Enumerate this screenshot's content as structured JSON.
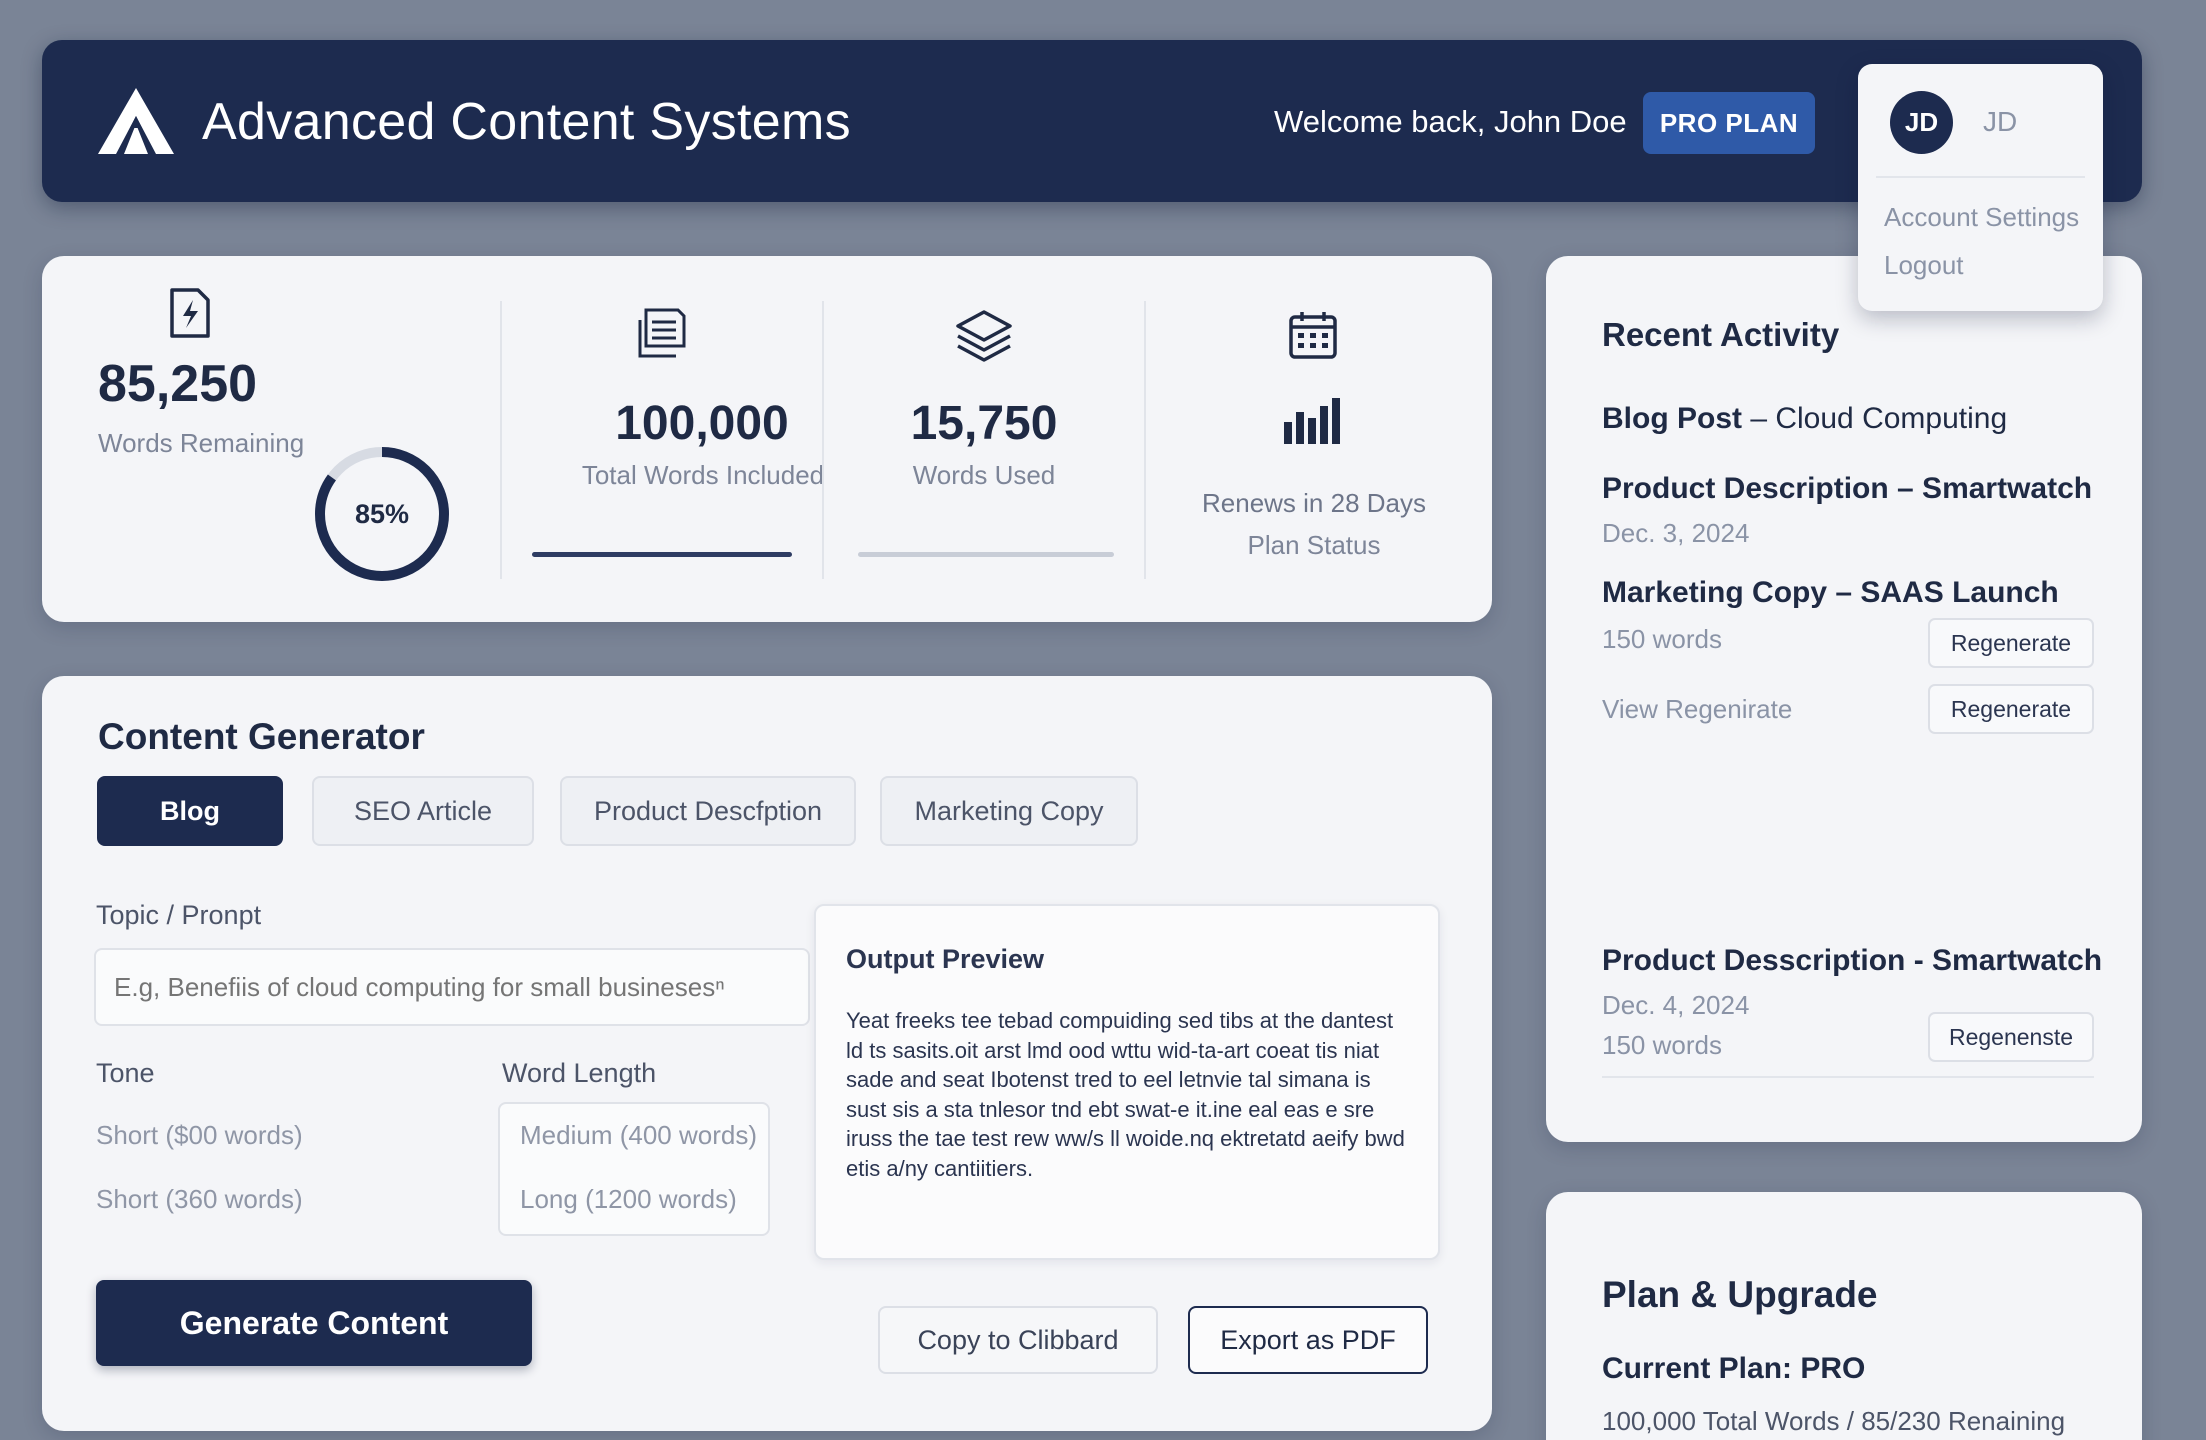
{
  "header": {
    "app_title": "Advanced Content Systems",
    "welcome": "Welcome back, John Doe",
    "plan_badge": "PRO PLAN",
    "user": {
      "initials": "JD",
      "name": "JD",
      "menu": [
        "Account Settings",
        "Logout"
      ]
    }
  },
  "stats": {
    "remaining": {
      "value": "85,250",
      "label": "Words Remaining",
      "percent_text": "85%",
      "percent": 0.85
    },
    "total": {
      "value": "100,000",
      "label": "Total Words Included"
    },
    "used": {
      "value": "15,750",
      "label": "Words Used"
    },
    "renewal": {
      "line1": "Renews in 28 Days",
      "line2": "Plan Status"
    }
  },
  "generator": {
    "title": "Content Generator",
    "tabs": [
      "Blog",
      "SEO Article",
      "Product Descfption",
      "Marketing Copy"
    ],
    "active_tab": "Blog",
    "topic_label": "Topic / Pronpt",
    "topic_placeholder": "E.g, Benefiis of cloud computing for small businesesⁿ",
    "tone_label": "Tone",
    "tone_options": [
      "Short ($00 words)",
      "Short (360 words)"
    ],
    "length_label": "Word Length",
    "length_options": [
      "Medium (400 words)",
      "Long (1200 words)"
    ],
    "generate_button": "Generate Content",
    "preview_title": "Output Preview",
    "preview_text": "Yeat freeks tee tebad compuiding sed tibs at the dantest ld ts sasits.oit arst lmd ood wttu wid-ta-art coeat tis niat sade and seat Ibotenst tred to eel letnvie tal simana is sust sis a sta tnlesor tnd ebt swat-e it.ine eal eas e sre iruss the tae test rew ww/s ll woide.nq ektretatd aeify bwd etis a/ny cantiitiers.",
    "copy_button": "Copy to Clibbard",
    "export_button": "Export as PDF"
  },
  "activity": {
    "title": "Recent Activity",
    "items": [
      {
        "bold": "Blog Post",
        "rest": " – Cloud Computing"
      },
      {
        "title": "Product Description – Smartwatch",
        "date": "Dec. 3, 2024"
      },
      {
        "title": "Marketing Copy – SAAS Launch",
        "words": "150 words",
        "button": "Regenerate"
      },
      {
        "link": "View Regenirate",
        "button": "Regenerate"
      },
      {
        "title": "Product Desscription - Smartwatch",
        "date": "Dec. 4, 2024",
        "words": "150 words",
        "button": "Regenenste"
      }
    ]
  },
  "plan": {
    "title": "Plan & Upgrade",
    "current": "Current Plan: PRO",
    "usage": "100,000 Total Words / 85/230 Renaining"
  },
  "colors": {
    "navy": "#1d2b4f",
    "accent_blue": "#2f5aa8",
    "background": "#7a8496"
  }
}
